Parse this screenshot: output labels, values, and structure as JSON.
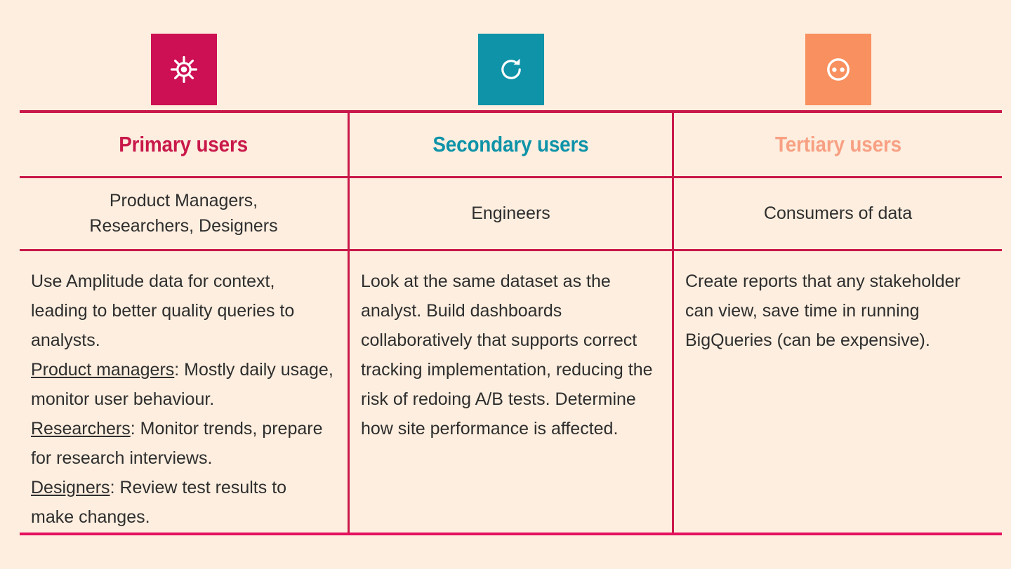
{
  "page": {
    "background_color": "#fdeedf",
    "title_row_icons": [
      {
        "name": "gear-icon",
        "background_color": "#cc1053",
        "glyph_color": "#ffffff"
      },
      {
        "name": "refresh-icon",
        "background_color": "#0e93a8",
        "glyph_color": "#ffffff"
      },
      {
        "name": "circle-two-dots-icon",
        "background_color": "#f9905f",
        "glyph_color": "#ffffff"
      }
    ],
    "accent_colors": {
      "crimson": "#c9184a",
      "teal": "#0e93a8",
      "salmon": "#f8a083",
      "rule": "#e5105e"
    }
  },
  "table": {
    "columns": [
      {
        "id": "primary",
        "header": "Primary users",
        "header_color": "#c9184a",
        "roles": "Product Managers, Researchers, Designers",
        "roles_lines": [
          "Product Managers,",
          "Researchers, Designers"
        ],
        "detail_intro": "Use Amplitude data for context, leading to better quality queries to analysts.",
        "detail_items": [
          {
            "label": "Product managers",
            "text": ": Mostly daily usage, monitor user behaviour."
          },
          {
            "label": "Researchers",
            "text": ": Monitor trends, prepare for research interviews."
          },
          {
            "label": "Designers",
            "text": ": Review test results to make changes."
          }
        ]
      },
      {
        "id": "secondary",
        "header": "Secondary users",
        "header_color": "#0e93a8",
        "roles": "Engineers",
        "roles_lines": [
          "Engineers"
        ],
        "detail_intro": "Look at the same dataset as the analyst. Build dashboards collaboratively that supports correct tracking implementation, reducing the risk of redoing A/B tests. Determine how site performance is affected.",
        "detail_items": []
      },
      {
        "id": "tertiary",
        "header": "Tertiary users",
        "header_color": "#f8a083",
        "roles": "Consumers of data",
        "roles_lines": [
          "Consumers of data"
        ],
        "detail_intro": "Create reports that any stakeholder can view, save time in running BigQueries (can be expensive).",
        "detail_items": []
      }
    ]
  }
}
